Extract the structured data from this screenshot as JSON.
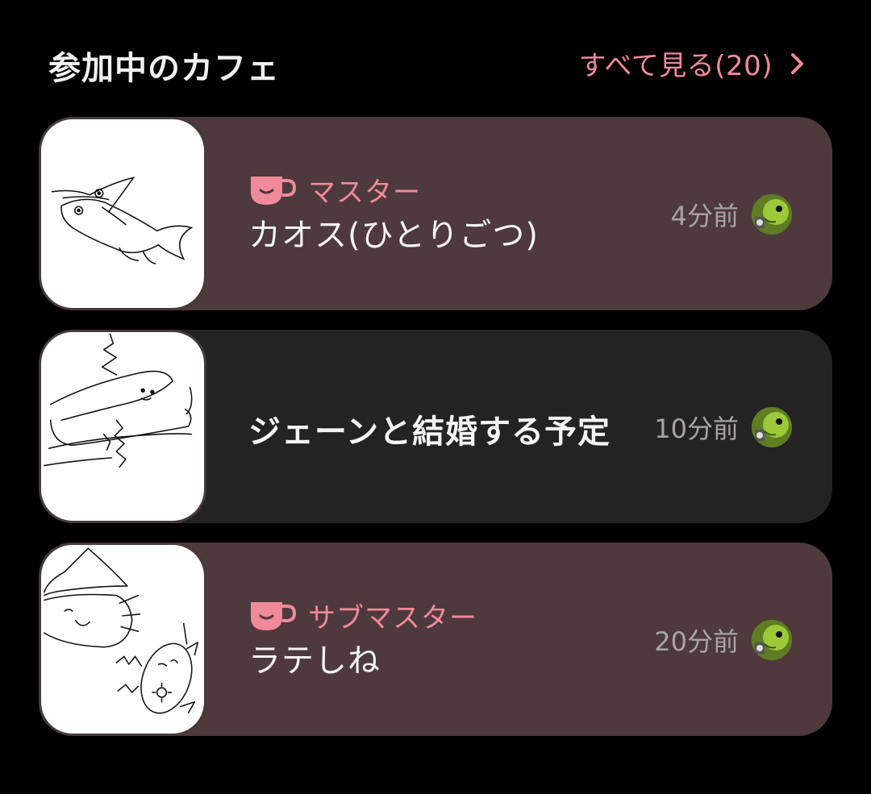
{
  "header": {
    "title": "参加中のカフェ",
    "see_all_label": "すべて見る(20)",
    "see_all_icon": "chevron-right-icon"
  },
  "colors": {
    "background": "#000000",
    "accent": "#f08a9a",
    "card_highlight": "#4e393c",
    "card_default": "#232323",
    "muted_text": "#a8a4a5"
  },
  "cafes": [
    {
      "role": "マスター",
      "role_icon": "coffee-cup-icon",
      "name": "カオス(ひとりごつ)",
      "time": "4分前",
      "thumbnail": "fish-sketch",
      "avatar": "bird-avatar"
    },
    {
      "role": "",
      "name": "ジェーンと結婚する予定",
      "time": "10分前",
      "thumbnail": "creature-sketch",
      "avatar": "bird-avatar"
    },
    {
      "role": "サブマスター",
      "role_icon": "coffee-cup-icon",
      "name": "ラテしね",
      "time": "20分前",
      "thumbnail": "witch-sketch",
      "avatar": "bird-avatar"
    }
  ]
}
